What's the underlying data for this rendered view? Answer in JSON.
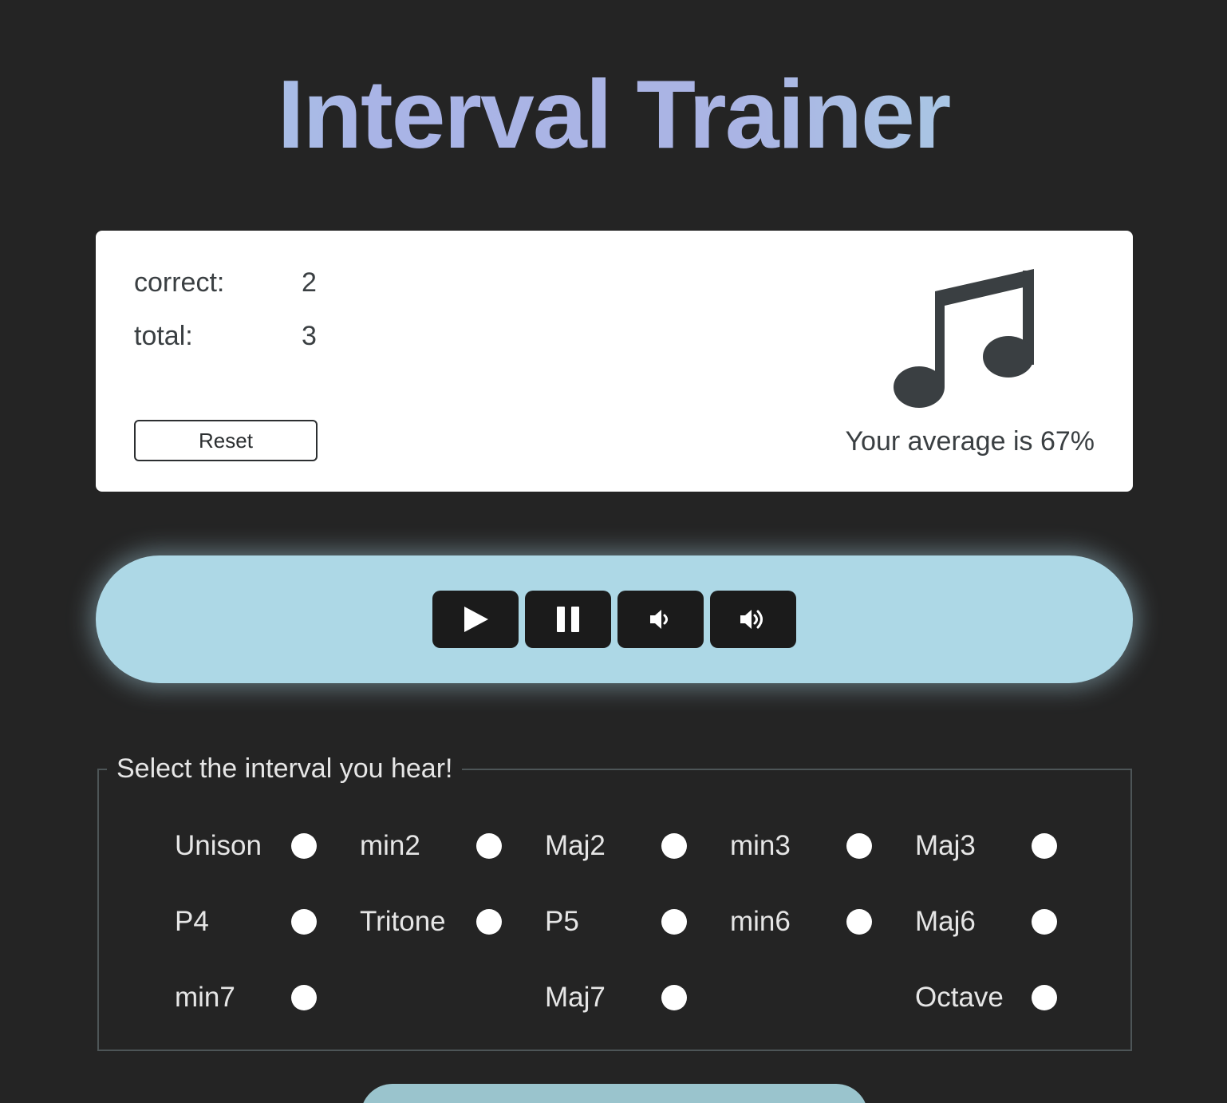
{
  "app": {
    "title": "Interval Trainer"
  },
  "score": {
    "correct_label": "correct:",
    "correct_value": "2",
    "total_label": "total:",
    "total_value": "3",
    "reset_label": "Reset",
    "average_text": "Your average is 67%",
    "icon": "music-note-icon"
  },
  "player": {
    "controls": [
      {
        "name": "play",
        "icon": "play-icon"
      },
      {
        "name": "pause",
        "icon": "pause-icon"
      },
      {
        "name": "volume-down",
        "icon": "volume-down-icon"
      },
      {
        "name": "volume-up",
        "icon": "volume-up-icon"
      }
    ]
  },
  "quiz": {
    "legend": "Select the interval you hear!",
    "options": [
      {
        "label": "Unison"
      },
      {
        "label": "min2"
      },
      {
        "label": "Maj2"
      },
      {
        "label": "min3"
      },
      {
        "label": "Maj3"
      },
      {
        "label": "P4"
      },
      {
        "label": "Tritone"
      },
      {
        "label": "P5"
      },
      {
        "label": "min6"
      },
      {
        "label": "Maj6"
      },
      {
        "label": "min7"
      },
      {
        "label": "Maj7"
      },
      {
        "label": "Octave"
      }
    ]
  },
  "colors": {
    "background": "#242424",
    "player_bar": "#add8e6",
    "card": "#ffffff",
    "title_gradient_start": "#a8dce4",
    "title_gradient_mid": "#a9b4e6"
  }
}
